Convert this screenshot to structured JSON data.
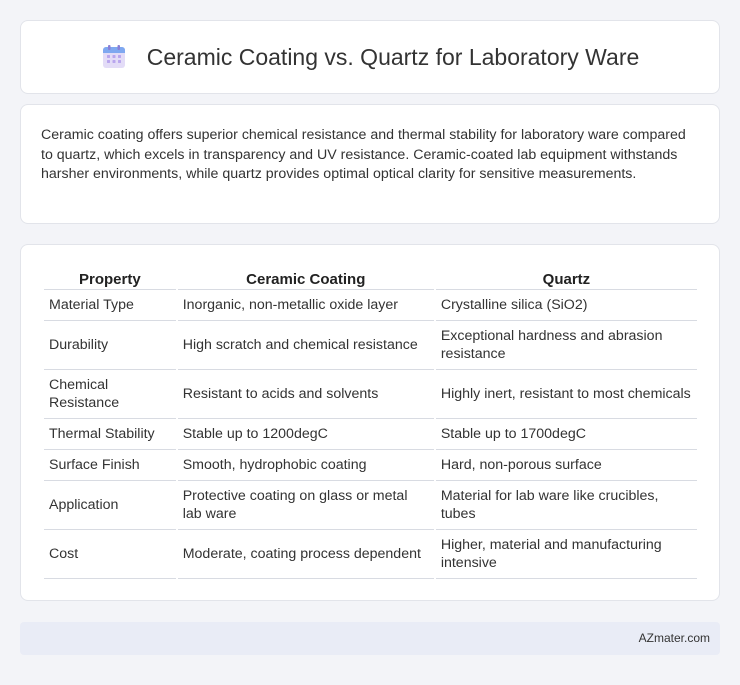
{
  "header": {
    "title": "Ceramic Coating vs. Quartz for Laboratory Ware",
    "icon": "calendar-icon"
  },
  "intro": {
    "text": "Ceramic coating offers superior chemical resistance and thermal stability for laboratory ware compared to quartz, which excels in transparency and UV resistance. Ceramic-coated lab equipment withstands harsher environments, while quartz provides optimal optical clarity for sensitive measurements."
  },
  "table": {
    "headers": [
      "Property",
      "Ceramic Coating",
      "Quartz"
    ],
    "rows": [
      [
        "Material Type",
        "Inorganic, non-metallic oxide layer",
        "Crystalline silica (SiO2)"
      ],
      [
        "Durability",
        "High scratch and chemical resistance",
        "Exceptional hardness and abrasion resistance"
      ],
      [
        "Chemical Resistance",
        "Resistant to acids and solvents",
        "Highly inert, resistant to most chemicals"
      ],
      [
        "Thermal Stability",
        "Stable up to 1200degC",
        "Stable up to 1700degC"
      ],
      [
        "Surface Finish",
        "Smooth, hydrophobic coating",
        "Hard, non-porous surface"
      ],
      [
        "Application",
        "Protective coating on glass or metal lab ware",
        "Material for lab ware like crucibles, tubes"
      ],
      [
        "Cost",
        "Moderate, coating process dependent",
        "Higher, material and manufacturing intensive"
      ]
    ]
  },
  "footer": {
    "brand": "AZmater.com"
  },
  "colors": {
    "background": "#f3f4f8",
    "card": "#ffffff",
    "footer": "#e9ecf6"
  }
}
